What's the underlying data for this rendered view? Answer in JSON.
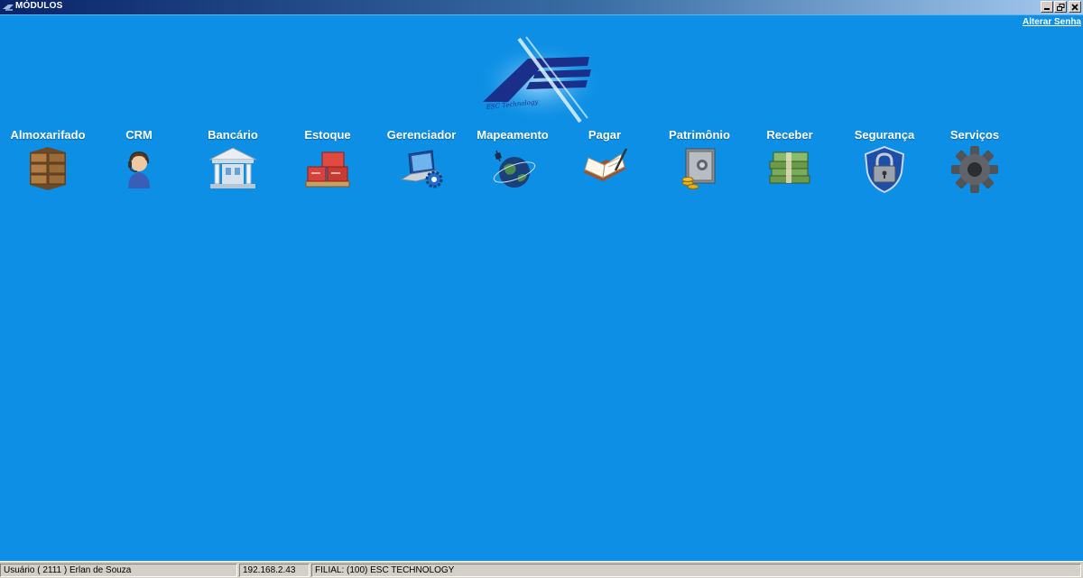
{
  "window": {
    "title": "MÓDULOS"
  },
  "header": {
    "change_password": "Alterar Senha",
    "logo_text": "ESC Technology"
  },
  "modules": [
    {
      "label": "Almoxarifado",
      "icon": "boxes-icon"
    },
    {
      "label": "CRM",
      "icon": "headset-agent-icon"
    },
    {
      "label": "Bancário",
      "icon": "bank-building-icon"
    },
    {
      "label": "Estoque",
      "icon": "pallet-boxes-icon"
    },
    {
      "label": "Gerenciador",
      "icon": "laptop-gear-icon"
    },
    {
      "label": "Mapeamento",
      "icon": "globe-satellite-icon"
    },
    {
      "label": "Pagar",
      "icon": "book-pen-icon"
    },
    {
      "label": "Patrimônio",
      "icon": "safe-coins-icon"
    },
    {
      "label": "Receber",
      "icon": "money-stack-icon"
    },
    {
      "label": "Segurança",
      "icon": "shield-lock-icon"
    },
    {
      "label": "Serviços",
      "icon": "gear-icon"
    }
  ],
  "status": {
    "user": "Usuário ( 2111 ) Erlan de Souza",
    "ip": "192.168.2.43",
    "branch": "FILIAL: (100) ESC TECHNOLOGY"
  },
  "colors": {
    "background": "#0c8fe4",
    "titlebar_start": "#0a246a",
    "titlebar_end": "#a6caf0"
  }
}
